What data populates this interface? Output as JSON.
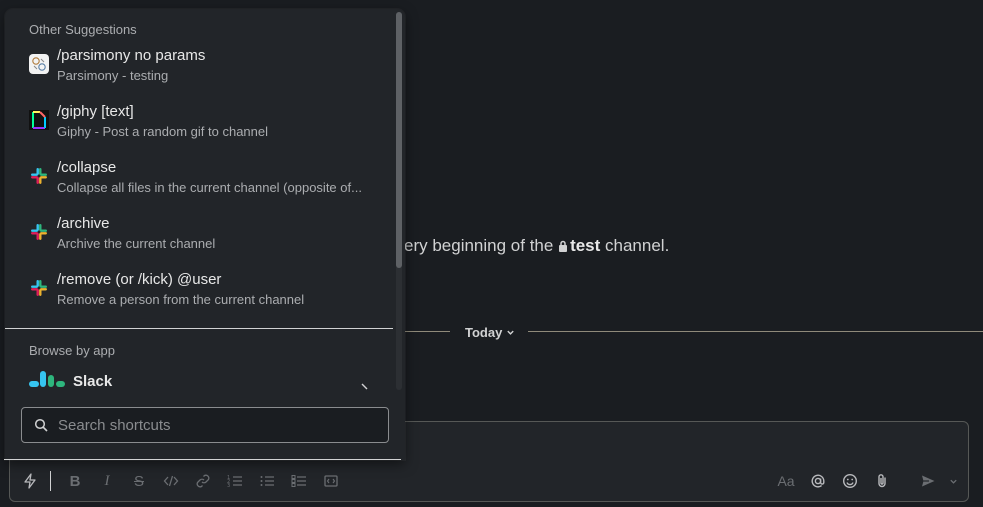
{
  "channel": {
    "intro_prefix": "ery beginning of the ",
    "name": "test",
    "intro_suffix": " channel."
  },
  "divider": {
    "label": "Today"
  },
  "popup": {
    "other_heading": "Other Suggestions",
    "items": [
      {
        "command": "/parsimony no params",
        "description": "Parsimony - testing",
        "icon": "parsimony-app-icon"
      },
      {
        "command": "/giphy [text]",
        "description": "Giphy - Post a random gif to channel",
        "icon": "giphy-icon"
      },
      {
        "command": "/collapse",
        "description": "Collapse all files in the current channel (opposite of...",
        "icon": "slack-icon"
      },
      {
        "command": "/archive",
        "description": "Archive the current channel",
        "icon": "slack-icon"
      },
      {
        "command": "/remove (or /kick) @user",
        "description": "Remove a person from the current channel",
        "icon": "slack-icon"
      }
    ],
    "browse_heading": "Browse by app",
    "app": {
      "name": "Slack"
    },
    "search": {
      "placeholder": "Search shortcuts",
      "value": ""
    }
  },
  "composer": {
    "format_label": "Aa"
  },
  "colors": {
    "background": "#1a1d21",
    "popup": "#222529",
    "slack_blue": "#36c5f0",
    "slack_green": "#2eb67d",
    "slack_red": "#e01e5a",
    "slack_yellow": "#ecb22e"
  }
}
